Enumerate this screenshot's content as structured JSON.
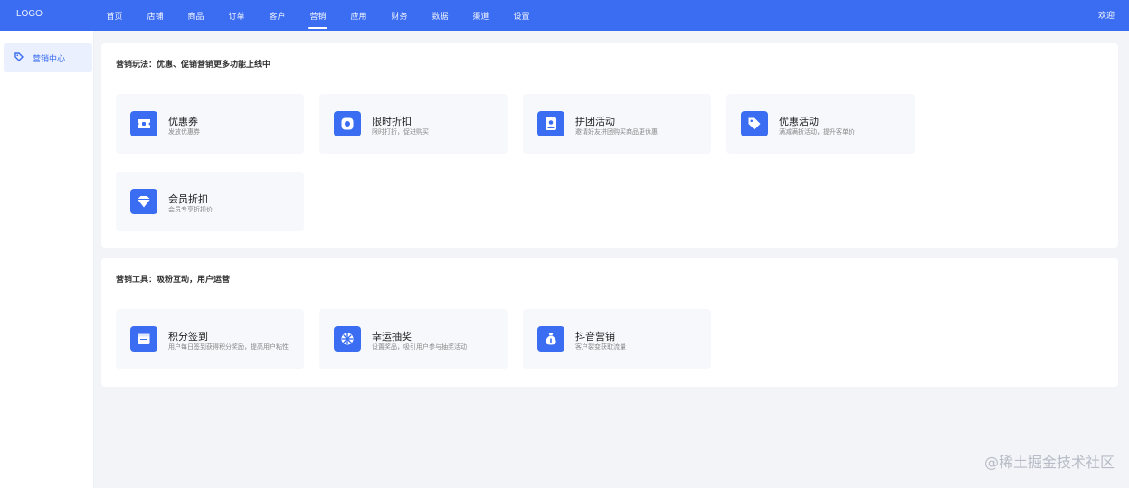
{
  "app": {
    "logo": "LOGO",
    "user": "欢迎"
  },
  "nav": [
    {
      "label": "首页"
    },
    {
      "label": "店铺"
    },
    {
      "label": "商品"
    },
    {
      "label": "订单"
    },
    {
      "label": "客户"
    },
    {
      "label": "营销",
      "active": true
    },
    {
      "label": "应用"
    },
    {
      "label": "财务"
    },
    {
      "label": "数据"
    },
    {
      "label": "渠道"
    },
    {
      "label": "设置"
    }
  ],
  "sidebar": {
    "items": [
      {
        "label": "营销中心",
        "icon": "tag-icon"
      }
    ]
  },
  "sections": [
    {
      "title": "营销玩法：优惠、促销营销更多功能上线中",
      "cards": [
        {
          "title": "优惠券",
          "desc": "发放优惠券",
          "icon": "ticket-icon"
        },
        {
          "title": "限时折扣",
          "desc": "限时打折，促进购买",
          "icon": "clock-icon"
        },
        {
          "title": "拼团活动",
          "desc": "邀请好友拼团购买商品更优惠",
          "icon": "user-icon"
        },
        {
          "title": "优惠活动",
          "desc": "满减满折活动，提升客单价",
          "icon": "price-tag-icon"
        },
        {
          "title": "会员折扣",
          "desc": "会员专享折扣价",
          "icon": "diamond-icon"
        }
      ]
    },
    {
      "title": "营销工具：吸粉互动，用户运营",
      "cards": [
        {
          "title": "积分签到",
          "desc": "用户每日签到获得积分奖励，提高用户粘性",
          "icon": "calendar-icon"
        },
        {
          "title": "幸运抽奖",
          "desc": "设置奖品，吸引用户参与抽奖活动",
          "icon": "wheel-icon"
        },
        {
          "title": "抖音营销",
          "desc": "客户裂变获取流量",
          "icon": "money-bag-icon"
        }
      ]
    }
  ],
  "watermark": "@稀土掘金技术社区",
  "colors": {
    "primary": "#3b6df2",
    "background": "#f2f4f8"
  }
}
